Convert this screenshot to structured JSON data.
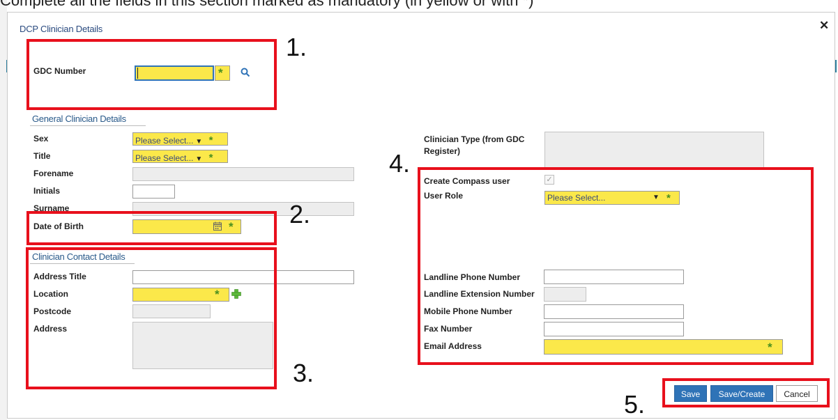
{
  "instruction": "Complete all the fields in this section marked as mandatory (in yellow or with *)",
  "dialog": {
    "title": "DCP Clinician Details"
  },
  "required_marker": "*",
  "gdc": {
    "label": "GDC Number",
    "value": ""
  },
  "general": {
    "title": "General Clinician Details",
    "sex": {
      "label": "Sex",
      "value": "Please Select..."
    },
    "title_field": {
      "label": "Title",
      "value": "Please Select..."
    },
    "forename": {
      "label": "Forename"
    },
    "initials": {
      "label": "Initials"
    },
    "surname": {
      "label": "Surname"
    },
    "dob": {
      "label": "Date of Birth"
    }
  },
  "contact": {
    "title": "Clinician Contact Details",
    "address_title": {
      "label": "Address Title"
    },
    "location": {
      "label": "Location"
    },
    "postcode": {
      "label": "Postcode"
    },
    "address": {
      "label": "Address"
    }
  },
  "right": {
    "clinician_type": {
      "label": "Clinician Type (from GDC Register)"
    },
    "create_compass": {
      "label": "Create Compass user",
      "checked": true
    },
    "user_role": {
      "label": "User Role",
      "value": "Please Select..."
    },
    "landline": {
      "label": "Landline Phone Number"
    },
    "extension": {
      "label": "Landline Extension Number"
    },
    "mobile": {
      "label": "Mobile Phone Number"
    },
    "fax": {
      "label": "Fax Number"
    },
    "email": {
      "label": "Email Address"
    }
  },
  "markers": {
    "m1": "1.",
    "m2": "2.",
    "m3": "3.",
    "m4": "4.",
    "m5": "5."
  },
  "buttons": {
    "save": "Save",
    "save_create": "Save/Create",
    "cancel": "Cancel"
  },
  "colors": {
    "required": "#fbe84a",
    "primary": "#2f73b7",
    "annotation": "#e8101c",
    "star": "#4a8f1f"
  }
}
